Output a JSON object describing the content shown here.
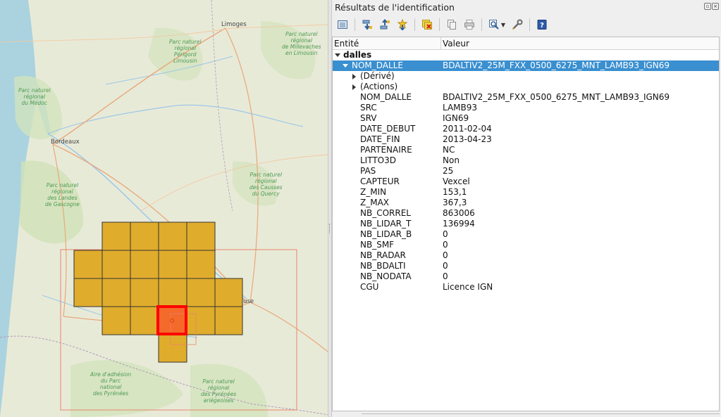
{
  "map": {
    "labels": {
      "charente": "Parc naturel\nrégional\nPérigord\nLimousin",
      "millevaches": "Parc naturel\nrégional\nde Millevaches\nen Limousin",
      "medoc": "Parc naturel\nrégional\ndu Médoc",
      "landes": "Parc naturel\nrégional\ndes Landes\nde Gascogne",
      "causses": "Parc naturel\nrégional\ndes Causses\ndu Quercy",
      "aire": "Aire d'adhésion\ndu Parc\nnational\ndes Pyrénées",
      "pyrenees": "Parc naturel\nrégional\ndes Pyrénées\nariégeoises"
    },
    "cities": {
      "limoges": "Limoges",
      "bordeaux": "Bordeaux",
      "toulouse": "use"
    }
  },
  "panel": {
    "title": "Résultats de l'identification",
    "float_icon": "float-icon",
    "close_icon": "close-icon",
    "toolbar": [
      {
        "name": "expand-tree-icon"
      },
      {
        "name": "expand-all-icon"
      },
      {
        "name": "collapse-all-icon"
      },
      {
        "name": "expand-new-results-icon"
      },
      {
        "name": "clear-results-icon"
      },
      {
        "name": "copy-feature-icon"
      },
      {
        "name": "print-icon"
      },
      {
        "name": "identify-mode-icon"
      },
      {
        "name": "identify-settings-icon"
      },
      {
        "name": "help-icon"
      }
    ]
  },
  "tree": {
    "col_entity": "Entité",
    "col_value": "Valeur",
    "layer": "dalles",
    "feature_key": "NOM_DALLE",
    "feature_value": "BDALTIV2_25M_FXX_0500_6275_MNT_LAMB93_IGN69",
    "derived": "(Dérivé)",
    "actions": "(Actions)",
    "attributes": [
      {
        "k": "NOM_DALLE",
        "v": "BDALTIV2_25M_FXX_0500_6275_MNT_LAMB93_IGN69"
      },
      {
        "k": "SRC",
        "v": "LAMB93"
      },
      {
        "k": "SRV",
        "v": "IGN69"
      },
      {
        "k": "DATE_DEBUT",
        "v": "2011-02-04"
      },
      {
        "k": "DATE_FIN",
        "v": "2013-04-23"
      },
      {
        "k": "PARTENAIRE",
        "v": "NC"
      },
      {
        "k": "LITTO3D",
        "v": "Non"
      },
      {
        "k": "PAS",
        "v": "25"
      },
      {
        "k": "CAPTEUR",
        "v": "Vexcel"
      },
      {
        "k": "Z_MIN",
        "v": "153,1"
      },
      {
        "k": "Z_MAX",
        "v": "367,3"
      },
      {
        "k": "NB_CORREL",
        "v": "863006"
      },
      {
        "k": "NB_LIDAR_T",
        "v": "136994"
      },
      {
        "k": "NB_LIDAR_B",
        "v": "0"
      },
      {
        "k": "NB_SMF",
        "v": "0"
      },
      {
        "k": "NB_RADAR",
        "v": "0"
      },
      {
        "k": "NB_BDALTI",
        "v": "0"
      },
      {
        "k": "NB_NODATA",
        "v": "0"
      },
      {
        "k": "CGU",
        "v": "Licence IGN"
      }
    ]
  },
  "colors": {
    "tile_fill": "#e0ac2c",
    "selected_tile": "#ff0000",
    "selection_row": "#3a8fd0",
    "park_label": "#4f9a55"
  }
}
